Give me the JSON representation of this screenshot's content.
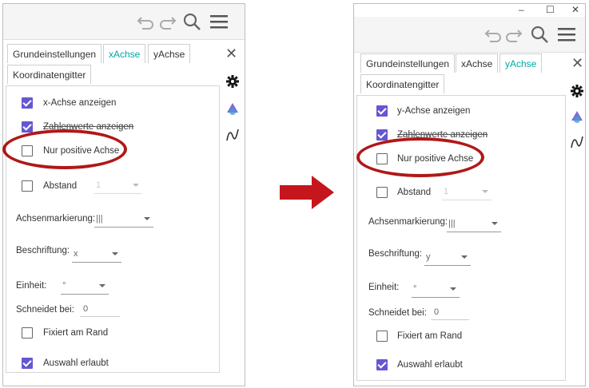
{
  "colors": {
    "accent": "#6557d2",
    "active_tab": "#00a8a8",
    "highlight": "#b01818",
    "arrow": "#c4161c"
  },
  "window": {
    "minimize": "–",
    "maximize": "☐",
    "close": "✕"
  },
  "toolbar": {
    "icons": [
      "undo-icon",
      "redo-icon",
      "search-icon",
      "menu-icon"
    ]
  },
  "side_icons": [
    "gear-icon",
    "shapes-icon",
    "graph-icon"
  ],
  "left": {
    "tabs": [
      "Grundeinstellungen",
      "xAchse",
      "yAchse",
      "Koordinatengitter"
    ],
    "active_tab": "xAchse",
    "close": "✕",
    "show_axis": {
      "label": "x-Achse anzeigen",
      "checked": true
    },
    "show_numbers": {
      "label": "Zahlenwerte anzeigen",
      "checked": true
    },
    "positive_only": {
      "label": "Nur positive Achse",
      "checked": false
    },
    "distance": {
      "label": "Abstand",
      "value": "1",
      "checked": false
    },
    "ticks": {
      "label": "Achsenmarkierung:",
      "value": "|||"
    },
    "caption": {
      "label": "Beschriftung:",
      "value": "x"
    },
    "unit": {
      "label": "Einheit:",
      "value": "°"
    },
    "cross": {
      "label": "Schneidet bei:",
      "value": "0"
    },
    "fixed": {
      "label": "Fixiert am Rand",
      "checked": false
    },
    "select": {
      "label": "Auswahl erlaubt",
      "checked": true
    }
  },
  "right": {
    "tabs": [
      "Grundeinstellungen",
      "xAchse",
      "yAchse",
      "Koordinatengitter"
    ],
    "active_tab": "yAchse",
    "close": "✕",
    "show_axis": {
      "label": "y-Achse anzeigen",
      "checked": true
    },
    "show_numbers": {
      "label": "Zahlenwerte anzeigen",
      "checked": true
    },
    "positive_only": {
      "label": "Nur positive Achse",
      "checked": false
    },
    "distance": {
      "label": "Abstand",
      "value": "1",
      "checked": false
    },
    "ticks": {
      "label": "Achsenmarkierung:",
      "value": "|||"
    },
    "caption": {
      "label": "Beschriftung:",
      "value": "y"
    },
    "unit": {
      "label": "Einheit:",
      "value": "°"
    },
    "cross": {
      "label": "Schneidet bei:",
      "value": "0"
    },
    "fixed": {
      "label": "Fixiert am Rand",
      "checked": false
    },
    "select": {
      "label": "Auswahl erlaubt",
      "checked": true
    }
  }
}
